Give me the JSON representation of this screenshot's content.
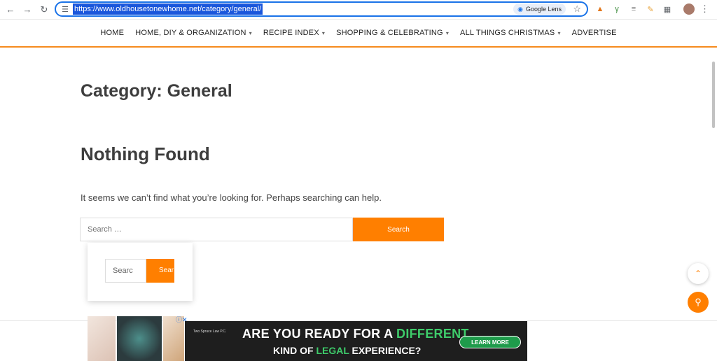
{
  "browser": {
    "url": "https://www.oldhousetonewhome.net/category/general/",
    "lens_label": "Google Lens"
  },
  "nav": {
    "items": [
      {
        "label": "HOME",
        "dropdown": false
      },
      {
        "label": "HOME, DIY & ORGANIZATION",
        "dropdown": true
      },
      {
        "label": "RECIPE INDEX",
        "dropdown": true
      },
      {
        "label": "SHOPPING & CELEBRATING",
        "dropdown": true
      },
      {
        "label": "ALL THINGS CHRISTMAS",
        "dropdown": true
      },
      {
        "label": "ADVERTISE",
        "dropdown": false
      }
    ],
    "accent": "#f68b1e"
  },
  "main": {
    "category_title": "Category: General",
    "nothing_title": "Nothing Found",
    "message": "It seems we can’t find what you’re looking for. Perhaps searching can help.",
    "search_placeholder": "Search …",
    "search_button": "Search"
  },
  "popup": {
    "input_text": "Searc",
    "button_text": "Sear"
  },
  "ad": {
    "headline_a": "ARE YOU READY FOR A ",
    "headline_hl": "DIFFERENT",
    "sub_a": "KIND OF ",
    "sub_hl": "LEGAL",
    "sub_b": " EXPERIENCE?",
    "cta": "LEARN MORE",
    "logo_text": "Two Spruce Law P.C."
  },
  "colors": {
    "orange": "#ff7f00",
    "link_blue": "#1a73e8"
  }
}
